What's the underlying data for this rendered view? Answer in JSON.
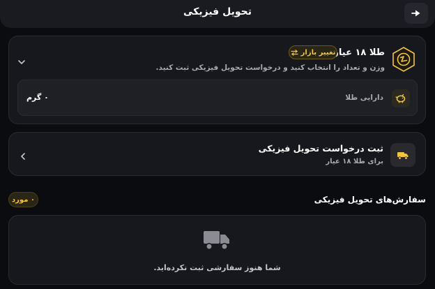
{
  "header": {
    "title": "تحویل فیزیکی",
    "back_icon": "arrow-right-icon"
  },
  "gold_card": {
    "title": "طلا ۱۸ عیار",
    "market_button": "تغییر بازار",
    "subtitle": "وزن و تعداد را انتخاب کنید و درخواست تحویل فیزیکی ثبت کنید.",
    "asset_label": "دارایی طلا",
    "asset_value": "۰ گرم",
    "accent": "#f2c440"
  },
  "request_card": {
    "title": "ثبت درخواست تحویل فیزیکی",
    "subtitle": "برای طلا ۱۸ عیار"
  },
  "orders": {
    "title": "سفارش‌های تحویل فیزیکی",
    "count": "۰ مورد",
    "empty_text": "شما هنوز سفارشی ثبت نکرده‌اید."
  }
}
